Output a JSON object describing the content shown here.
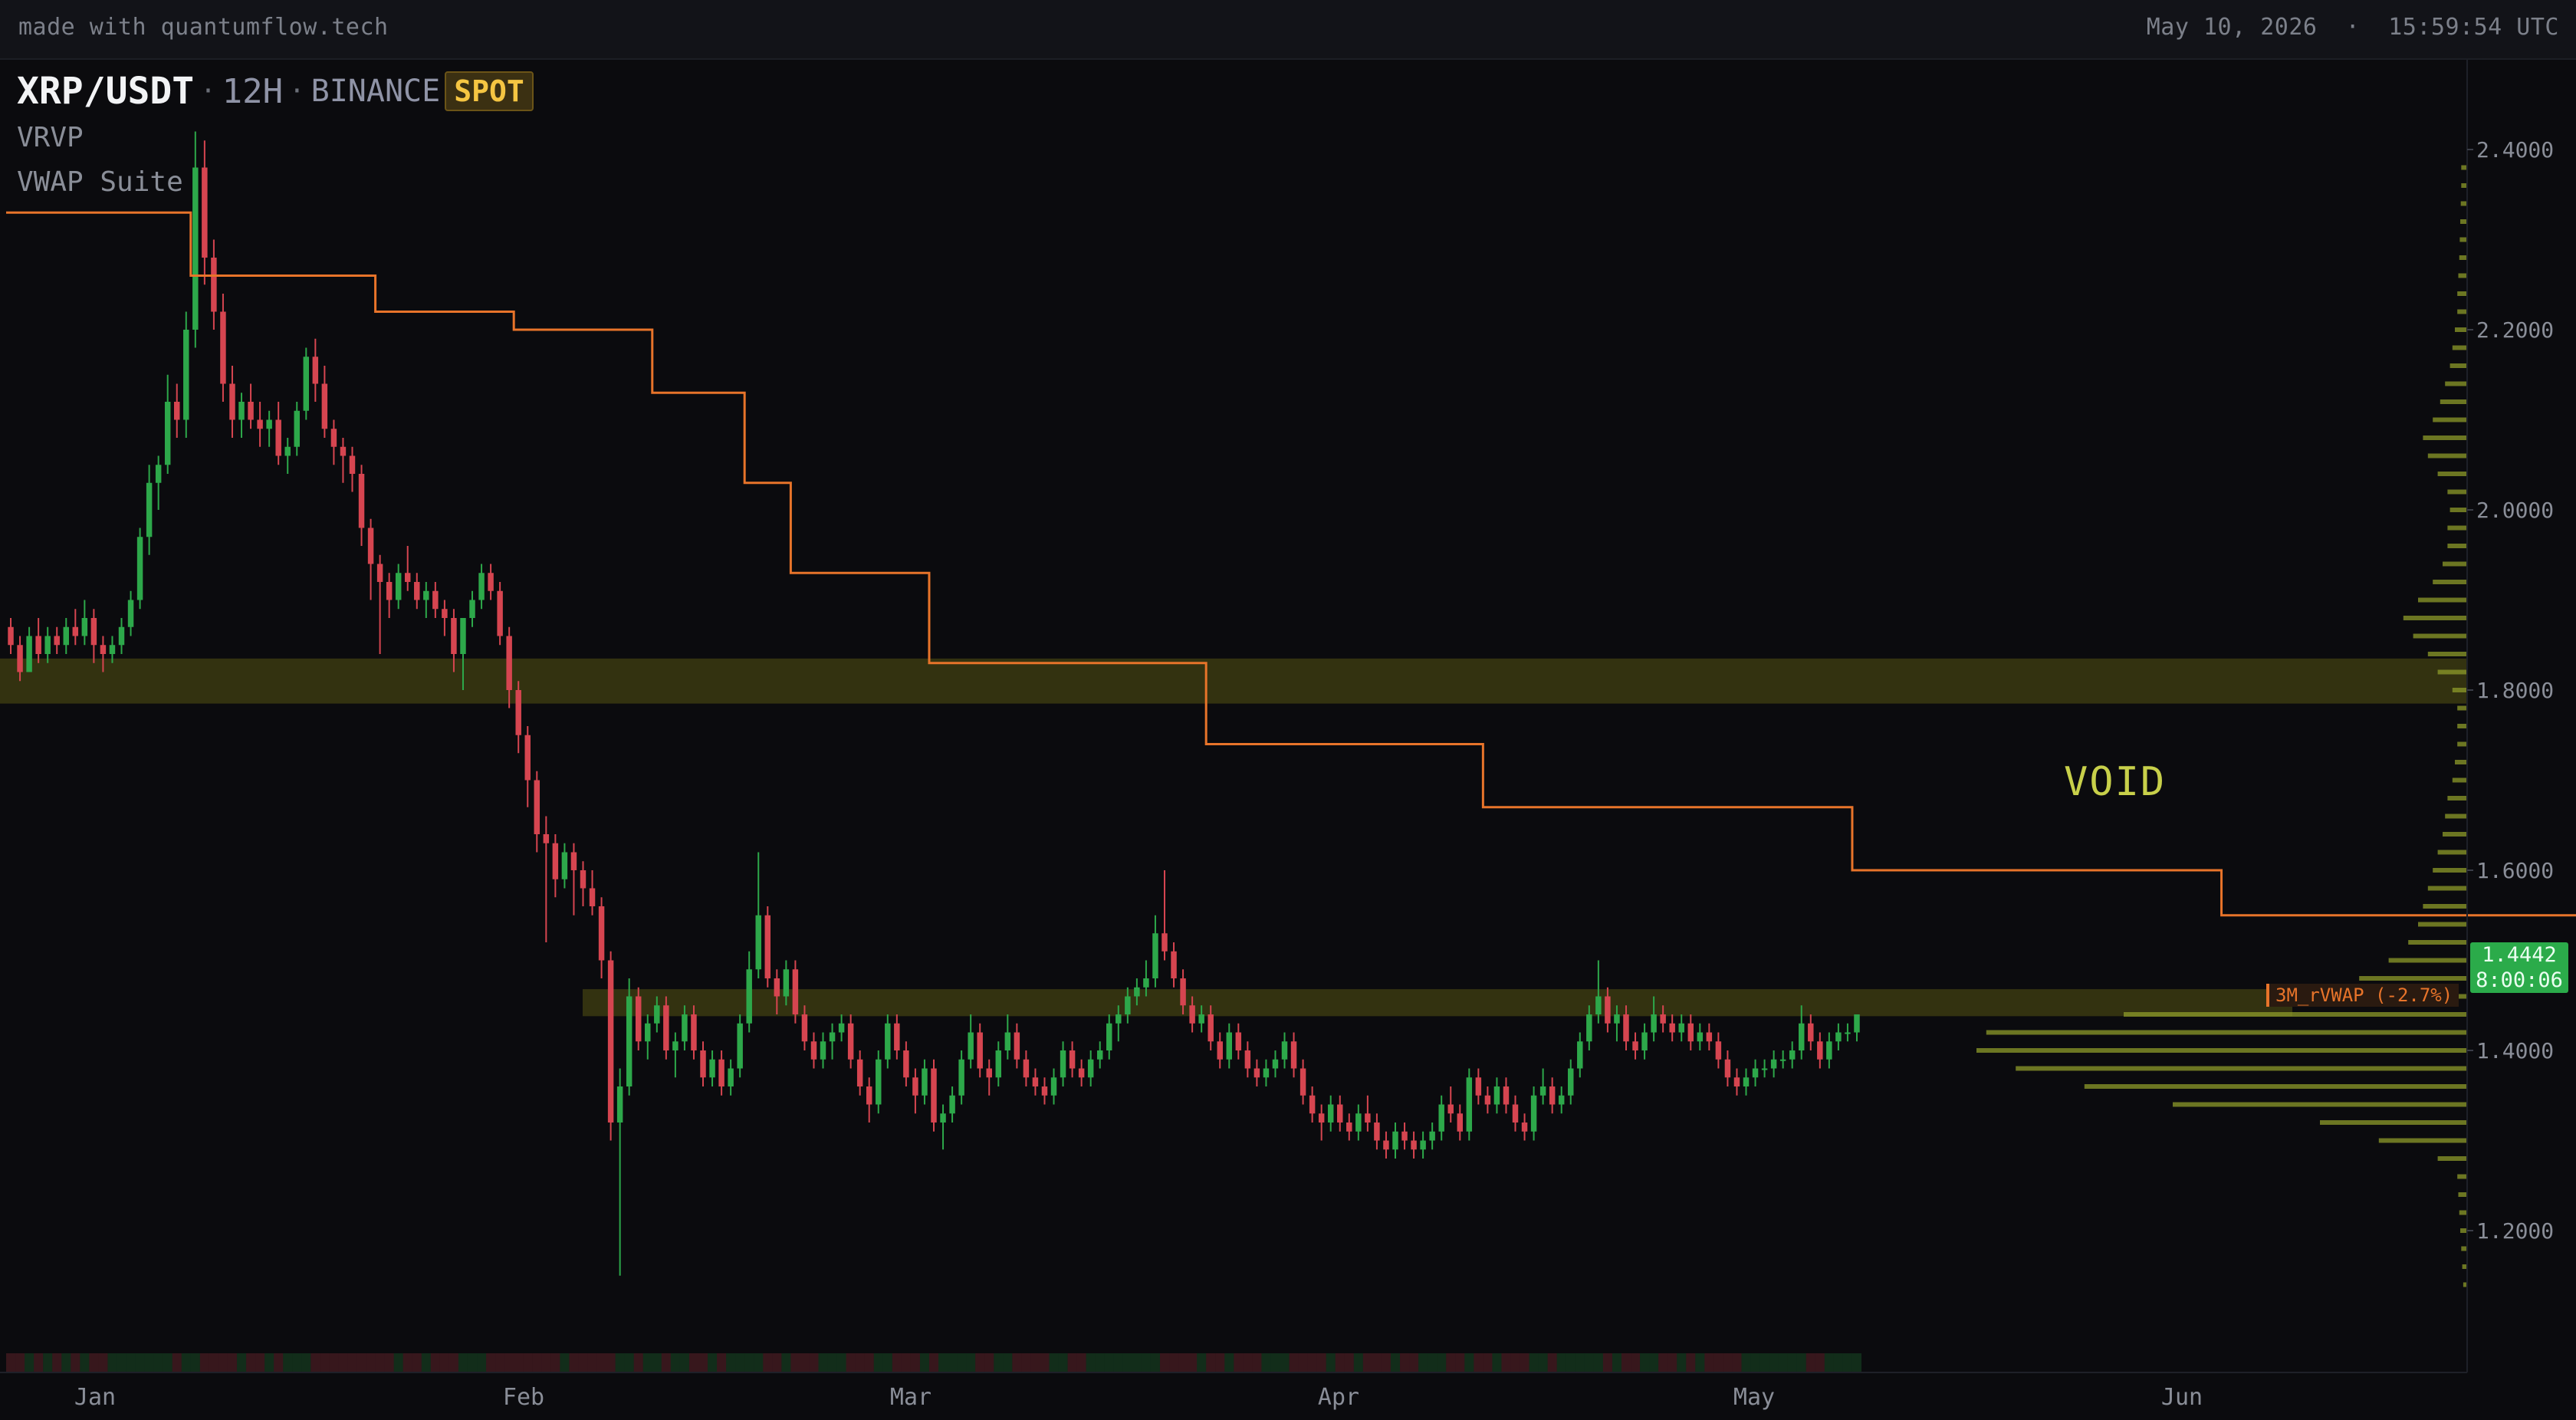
{
  "topbar": {
    "brand": "made with quantumflow.tech",
    "datetime": "May 10, 2026  ·  15:59:54 UTC"
  },
  "header": {
    "symbol": "XRP/USDT",
    "timeframe": "12H",
    "exchange": "BINANCE",
    "market": "SPOT",
    "indicators": [
      "VRVP",
      "VWAP Suite"
    ]
  },
  "annotations": {
    "void_label": "VOID",
    "last_price": "1.4442",
    "countdown": "8:00:06",
    "vwap_label": "3M_rVWAP (-2.7%)"
  },
  "colors": {
    "up": "#2da84a",
    "down": "#d64550",
    "vwap": "#e8742a",
    "profile": "#8d9b2a",
    "zone": "#6b6a14",
    "background": "#0b0b0e"
  },
  "chart_data": {
    "type": "candlestick",
    "y_ticks": [
      "2.4000",
      "2.2000",
      "2.0000",
      "1.8000",
      "1.6000",
      "1.4000",
      "1.2000"
    ],
    "x_ticks": [
      "Jan",
      "Feb",
      "Mar",
      "Apr",
      "May",
      "Jun"
    ],
    "y_range": [
      1.12,
      2.4
    ],
    "zones": [
      {
        "low": 1.785,
        "high": 1.835
      },
      {
        "low": 1.438,
        "high": 1.468
      }
    ],
    "ohlc": [
      [
        1.87,
        1.88,
        1.84,
        1.85
      ],
      [
        1.85,
        1.86,
        1.81,
        1.82
      ],
      [
        1.82,
        1.87,
        1.82,
        1.86
      ],
      [
        1.86,
        1.88,
        1.83,
        1.84
      ],
      [
        1.84,
        1.87,
        1.83,
        1.86
      ],
      [
        1.86,
        1.87,
        1.84,
        1.85
      ],
      [
        1.85,
        1.88,
        1.84,
        1.87
      ],
      [
        1.87,
        1.89,
        1.85,
        1.86
      ],
      [
        1.86,
        1.9,
        1.85,
        1.88
      ],
      [
        1.88,
        1.89,
        1.83,
        1.85
      ],
      [
        1.85,
        1.86,
        1.82,
        1.84
      ],
      [
        1.84,
        1.86,
        1.83,
        1.85
      ],
      [
        1.85,
        1.88,
        1.84,
        1.87
      ],
      [
        1.87,
        1.91,
        1.86,
        1.9
      ],
      [
        1.9,
        1.98,
        1.89,
        1.97
      ],
      [
        1.97,
        2.05,
        1.95,
        2.03
      ],
      [
        2.03,
        2.06,
        2.0,
        2.05
      ],
      [
        2.05,
        2.15,
        2.04,
        2.12
      ],
      [
        2.12,
        2.14,
        2.08,
        2.1
      ],
      [
        2.1,
        2.22,
        2.08,
        2.2
      ],
      [
        2.2,
        2.42,
        2.18,
        2.38
      ],
      [
        2.38,
        2.41,
        2.25,
        2.28
      ],
      [
        2.28,
        2.3,
        2.2,
        2.22
      ],
      [
        2.22,
        2.24,
        2.12,
        2.14
      ],
      [
        2.14,
        2.16,
        2.08,
        2.1
      ],
      [
        2.1,
        2.13,
        2.08,
        2.12
      ],
      [
        2.12,
        2.14,
        2.09,
        2.1
      ],
      [
        2.1,
        2.12,
        2.07,
        2.09
      ],
      [
        2.09,
        2.11,
        2.07,
        2.1
      ],
      [
        2.1,
        2.12,
        2.05,
        2.06
      ],
      [
        2.06,
        2.08,
        2.04,
        2.07
      ],
      [
        2.07,
        2.12,
        2.06,
        2.11
      ],
      [
        2.11,
        2.18,
        2.1,
        2.17
      ],
      [
        2.17,
        2.19,
        2.12,
        2.14
      ],
      [
        2.14,
        2.16,
        2.08,
        2.09
      ],
      [
        2.09,
        2.1,
        2.05,
        2.07
      ],
      [
        2.07,
        2.08,
        2.03,
        2.06
      ],
      [
        2.06,
        2.07,
        2.02,
        2.04
      ],
      [
        2.04,
        2.05,
        1.96,
        1.98
      ],
      [
        1.98,
        1.99,
        1.9,
        1.94
      ],
      [
        1.94,
        1.95,
        1.84,
        1.92
      ],
      [
        1.92,
        1.93,
        1.88,
        1.9
      ],
      [
        1.9,
        1.94,
        1.89,
        1.93
      ],
      [
        1.93,
        1.96,
        1.91,
        1.92
      ],
      [
        1.92,
        1.93,
        1.89,
        1.9
      ],
      [
        1.9,
        1.92,
        1.88,
        1.91
      ],
      [
        1.91,
        1.92,
        1.88,
        1.89
      ],
      [
        1.89,
        1.9,
        1.86,
        1.88
      ],
      [
        1.88,
        1.89,
        1.82,
        1.84
      ],
      [
        1.84,
        1.85,
        1.8,
        1.88
      ],
      [
        1.88,
        1.91,
        1.87,
        1.9
      ],
      [
        1.9,
        1.94,
        1.89,
        1.93
      ],
      [
        1.93,
        1.94,
        1.9,
        1.91
      ],
      [
        1.91,
        1.92,
        1.85,
        1.86
      ],
      [
        1.86,
        1.87,
        1.78,
        1.8
      ],
      [
        1.8,
        1.81,
        1.73,
        1.75
      ],
      [
        1.75,
        1.76,
        1.67,
        1.7
      ],
      [
        1.7,
        1.71,
        1.62,
        1.64
      ],
      [
        1.64,
        1.66,
        1.52,
        1.63
      ],
      [
        1.63,
        1.64,
        1.57,
        1.59
      ],
      [
        1.59,
        1.63,
        1.58,
        1.62
      ],
      [
        1.62,
        1.63,
        1.55,
        1.6
      ],
      [
        1.6,
        1.61,
        1.56,
        1.58
      ],
      [
        1.58,
        1.6,
        1.55,
        1.56
      ],
      [
        1.56,
        1.57,
        1.48,
        1.5
      ],
      [
        1.5,
        1.51,
        1.3,
        1.32
      ],
      [
        1.32,
        1.38,
        1.15,
        1.36
      ],
      [
        1.36,
        1.48,
        1.35,
        1.46
      ],
      [
        1.46,
        1.47,
        1.4,
        1.41
      ],
      [
        1.41,
        1.44,
        1.39,
        1.43
      ],
      [
        1.43,
        1.46,
        1.42,
        1.45
      ],
      [
        1.45,
        1.46,
        1.39,
        1.4
      ],
      [
        1.4,
        1.42,
        1.37,
        1.41
      ],
      [
        1.41,
        1.45,
        1.4,
        1.44
      ],
      [
        1.44,
        1.45,
        1.39,
        1.4
      ],
      [
        1.4,
        1.41,
        1.36,
        1.37
      ],
      [
        1.37,
        1.4,
        1.36,
        1.39
      ],
      [
        1.39,
        1.4,
        1.35,
        1.36
      ],
      [
        1.36,
        1.39,
        1.35,
        1.38
      ],
      [
        1.38,
        1.44,
        1.37,
        1.43
      ],
      [
        1.43,
        1.51,
        1.42,
        1.49
      ],
      [
        1.49,
        1.62,
        1.48,
        1.55
      ],
      [
        1.55,
        1.56,
        1.47,
        1.48
      ],
      [
        1.48,
        1.49,
        1.44,
        1.46
      ],
      [
        1.46,
        1.5,
        1.45,
        1.49
      ],
      [
        1.49,
        1.5,
        1.43,
        1.44
      ],
      [
        1.44,
        1.45,
        1.4,
        1.41
      ],
      [
        1.41,
        1.42,
        1.38,
        1.39
      ],
      [
        1.39,
        1.42,
        1.38,
        1.41
      ],
      [
        1.41,
        1.43,
        1.39,
        1.42
      ],
      [
        1.42,
        1.44,
        1.41,
        1.43
      ],
      [
        1.43,
        1.44,
        1.38,
        1.39
      ],
      [
        1.39,
        1.4,
        1.35,
        1.36
      ],
      [
        1.36,
        1.37,
        1.32,
        1.34
      ],
      [
        1.34,
        1.4,
        1.33,
        1.39
      ],
      [
        1.39,
        1.44,
        1.38,
        1.43
      ],
      [
        1.43,
        1.44,
        1.39,
        1.4
      ],
      [
        1.4,
        1.41,
        1.36,
        1.37
      ],
      [
        1.37,
        1.38,
        1.33,
        1.35
      ],
      [
        1.35,
        1.39,
        1.34,
        1.38
      ],
      [
        1.38,
        1.39,
        1.31,
        1.32
      ],
      [
        1.32,
        1.34,
        1.29,
        1.33
      ],
      [
        1.33,
        1.36,
        1.32,
        1.35
      ],
      [
        1.35,
        1.4,
        1.34,
        1.39
      ],
      [
        1.39,
        1.44,
        1.38,
        1.42
      ],
      [
        1.42,
        1.43,
        1.37,
        1.38
      ],
      [
        1.38,
        1.39,
        1.35,
        1.37
      ],
      [
        1.37,
        1.41,
        1.36,
        1.4
      ],
      [
        1.4,
        1.44,
        1.39,
        1.42
      ],
      [
        1.42,
        1.43,
        1.38,
        1.39
      ],
      [
        1.39,
        1.4,
        1.36,
        1.37
      ],
      [
        1.37,
        1.38,
        1.35,
        1.36
      ],
      [
        1.36,
        1.37,
        1.34,
        1.35
      ],
      [
        1.35,
        1.38,
        1.34,
        1.37
      ],
      [
        1.37,
        1.41,
        1.36,
        1.4
      ],
      [
        1.4,
        1.41,
        1.37,
        1.38
      ],
      [
        1.38,
        1.39,
        1.36,
        1.37
      ],
      [
        1.37,
        1.4,
        1.36,
        1.39
      ],
      [
        1.39,
        1.41,
        1.38,
        1.4
      ],
      [
        1.4,
        1.44,
        1.39,
        1.43
      ],
      [
        1.43,
        1.45,
        1.41,
        1.44
      ],
      [
        1.44,
        1.47,
        1.43,
        1.46
      ],
      [
        1.46,
        1.48,
        1.45,
        1.47
      ],
      [
        1.47,
        1.5,
        1.46,
        1.48
      ],
      [
        1.48,
        1.55,
        1.47,
        1.53
      ],
      [
        1.53,
        1.6,
        1.5,
        1.51
      ],
      [
        1.51,
        1.52,
        1.47,
        1.48
      ],
      [
        1.48,
        1.49,
        1.44,
        1.45
      ],
      [
        1.45,
        1.46,
        1.42,
        1.43
      ],
      [
        1.43,
        1.45,
        1.42,
        1.44
      ],
      [
        1.44,
        1.45,
        1.4,
        1.41
      ],
      [
        1.41,
        1.42,
        1.38,
        1.39
      ],
      [
        1.39,
        1.43,
        1.38,
        1.42
      ],
      [
        1.42,
        1.43,
        1.39,
        1.4
      ],
      [
        1.4,
        1.41,
        1.37,
        1.38
      ],
      [
        1.38,
        1.39,
        1.36,
        1.37
      ],
      [
        1.37,
        1.39,
        1.36,
        1.38
      ],
      [
        1.38,
        1.4,
        1.37,
        1.39
      ],
      [
        1.39,
        1.42,
        1.38,
        1.41
      ],
      [
        1.41,
        1.42,
        1.37,
        1.38
      ],
      [
        1.38,
        1.39,
        1.34,
        1.35
      ],
      [
        1.35,
        1.36,
        1.32,
        1.33
      ],
      [
        1.33,
        1.34,
        1.3,
        1.32
      ],
      [
        1.32,
        1.35,
        1.31,
        1.34
      ],
      [
        1.34,
        1.35,
        1.31,
        1.32
      ],
      [
        1.32,
        1.33,
        1.3,
        1.31
      ],
      [
        1.31,
        1.34,
        1.3,
        1.33
      ],
      [
        1.33,
        1.35,
        1.31,
        1.32
      ],
      [
        1.32,
        1.33,
        1.29,
        1.3
      ],
      [
        1.3,
        1.31,
        1.28,
        1.29
      ],
      [
        1.29,
        1.32,
        1.28,
        1.31
      ],
      [
        1.31,
        1.32,
        1.29,
        1.3
      ],
      [
        1.3,
        1.31,
        1.28,
        1.29
      ],
      [
        1.29,
        1.31,
        1.28,
        1.3
      ],
      [
        1.3,
        1.32,
        1.29,
        1.31
      ],
      [
        1.31,
        1.35,
        1.3,
        1.34
      ],
      [
        1.34,
        1.36,
        1.32,
        1.33
      ],
      [
        1.33,
        1.34,
        1.3,
        1.31
      ],
      [
        1.31,
        1.38,
        1.3,
        1.37
      ],
      [
        1.37,
        1.38,
        1.34,
        1.35
      ],
      [
        1.35,
        1.36,
        1.33,
        1.34
      ],
      [
        1.34,
        1.37,
        1.33,
        1.36
      ],
      [
        1.36,
        1.37,
        1.33,
        1.34
      ],
      [
        1.34,
        1.35,
        1.31,
        1.32
      ],
      [
        1.32,
        1.33,
        1.3,
        1.31
      ],
      [
        1.31,
        1.36,
        1.3,
        1.35
      ],
      [
        1.35,
        1.38,
        1.34,
        1.36
      ],
      [
        1.36,
        1.37,
        1.33,
        1.34
      ],
      [
        1.34,
        1.36,
        1.33,
        1.35
      ],
      [
        1.35,
        1.39,
        1.34,
        1.38
      ],
      [
        1.38,
        1.42,
        1.37,
        1.41
      ],
      [
        1.41,
        1.45,
        1.4,
        1.44
      ],
      [
        1.44,
        1.5,
        1.43,
        1.46
      ],
      [
        1.46,
        1.47,
        1.42,
        1.43
      ],
      [
        1.43,
        1.45,
        1.41,
        1.44
      ],
      [
        1.44,
        1.45,
        1.4,
        1.41
      ],
      [
        1.41,
        1.42,
        1.39,
        1.4
      ],
      [
        1.4,
        1.43,
        1.39,
        1.42
      ],
      [
        1.42,
        1.46,
        1.41,
        1.44
      ],
      [
        1.44,
        1.45,
        1.42,
        1.43
      ],
      [
        1.43,
        1.44,
        1.41,
        1.42
      ],
      [
        1.42,
        1.44,
        1.41,
        1.43
      ],
      [
        1.43,
        1.44,
        1.4,
        1.41
      ],
      [
        1.41,
        1.43,
        1.4,
        1.42
      ],
      [
        1.42,
        1.43,
        1.4,
        1.41
      ],
      [
        1.41,
        1.42,
        1.38,
        1.39
      ],
      [
        1.39,
        1.4,
        1.36,
        1.37
      ],
      [
        1.37,
        1.38,
        1.35,
        1.36
      ],
      [
        1.36,
        1.38,
        1.35,
        1.37
      ],
      [
        1.37,
        1.39,
        1.36,
        1.38
      ],
      [
        1.38,
        1.39,
        1.37,
        1.38
      ],
      [
        1.38,
        1.4,
        1.37,
        1.39
      ],
      [
        1.39,
        1.4,
        1.38,
        1.39
      ],
      [
        1.39,
        1.41,
        1.38,
        1.4
      ],
      [
        1.4,
        1.45,
        1.39,
        1.43
      ],
      [
        1.43,
        1.44,
        1.4,
        1.41
      ],
      [
        1.41,
        1.42,
        1.38,
        1.39
      ],
      [
        1.39,
        1.42,
        1.38,
        1.41
      ],
      [
        1.41,
        1.43,
        1.4,
        1.42
      ],
      [
        1.42,
        1.43,
        1.41,
        1.42
      ],
      [
        1.42,
        1.44,
        1.41,
        1.44
      ]
    ],
    "vwap_line": [
      [
        0,
        2.33
      ],
      [
        20,
        2.26
      ],
      [
        40,
        2.22
      ],
      [
        55,
        2.2
      ],
      [
        70,
        2.13
      ],
      [
        80,
        2.03
      ],
      [
        85,
        1.93
      ],
      [
        100,
        1.83
      ],
      [
        130,
        1.74
      ],
      [
        160,
        1.67
      ],
      [
        200,
        1.6
      ],
      [
        240,
        1.55
      ],
      [
        300,
        1.48
      ],
      [
        330,
        1.44
      ],
      [
        380,
        1.41
      ]
    ],
    "volume_profile": [
      [
        1.14,
        0.008
      ],
      [
        1.16,
        0.01
      ],
      [
        1.18,
        0.012
      ],
      [
        1.2,
        0.014
      ],
      [
        1.22,
        0.016
      ],
      [
        1.24,
        0.018
      ],
      [
        1.26,
        0.02
      ],
      [
        1.28,
        0.06
      ],
      [
        1.3,
        0.18
      ],
      [
        1.32,
        0.3
      ],
      [
        1.34,
        0.6
      ],
      [
        1.36,
        0.78
      ],
      [
        1.38,
        0.92
      ],
      [
        1.4,
        1.0
      ],
      [
        1.42,
        0.98
      ],
      [
        1.44,
        0.7
      ],
      [
        1.46,
        0.38
      ],
      [
        1.48,
        0.22
      ],
      [
        1.5,
        0.16
      ],
      [
        1.52,
        0.12
      ],
      [
        1.54,
        0.1
      ],
      [
        1.56,
        0.09
      ],
      [
        1.58,
        0.08
      ],
      [
        1.6,
        0.07
      ],
      [
        1.62,
        0.06
      ],
      [
        1.64,
        0.05
      ],
      [
        1.66,
        0.045
      ],
      [
        1.68,
        0.04
      ],
      [
        1.7,
        0.03
      ],
      [
        1.72,
        0.025
      ],
      [
        1.74,
        0.02
      ],
      [
        1.76,
        0.02
      ],
      [
        1.78,
        0.02
      ],
      [
        1.8,
        0.03
      ],
      [
        1.82,
        0.06
      ],
      [
        1.84,
        0.08
      ],
      [
        1.86,
        0.11
      ],
      [
        1.88,
        0.13
      ],
      [
        1.9,
        0.1
      ],
      [
        1.92,
        0.07
      ],
      [
        1.94,
        0.05
      ],
      [
        1.96,
        0.04
      ],
      [
        1.98,
        0.04
      ],
      [
        2.0,
        0.035
      ],
      [
        2.02,
        0.04
      ],
      [
        2.04,
        0.06
      ],
      [
        2.06,
        0.08
      ],
      [
        2.08,
        0.09
      ],
      [
        2.1,
        0.07
      ],
      [
        2.12,
        0.055
      ],
      [
        2.14,
        0.045
      ],
      [
        2.16,
        0.035
      ],
      [
        2.18,
        0.03
      ],
      [
        2.2,
        0.025
      ],
      [
        2.22,
        0.02
      ],
      [
        2.24,
        0.02
      ],
      [
        2.26,
        0.018
      ],
      [
        2.28,
        0.016
      ],
      [
        2.3,
        0.015
      ],
      [
        2.32,
        0.014
      ],
      [
        2.34,
        0.013
      ],
      [
        2.36,
        0.012
      ],
      [
        2.38,
        0.012
      ]
    ]
  }
}
